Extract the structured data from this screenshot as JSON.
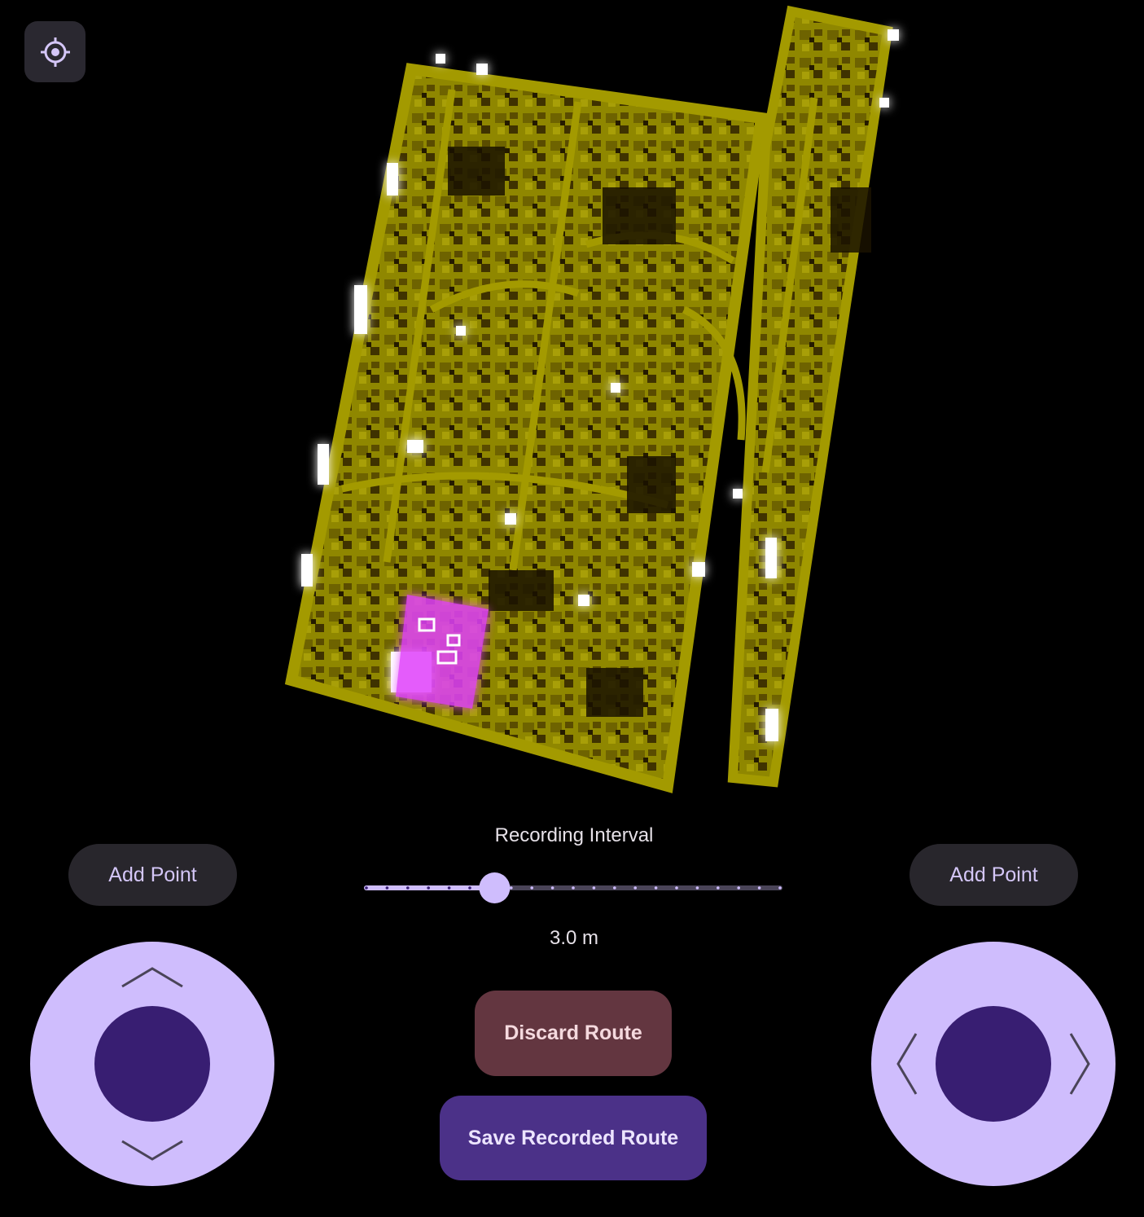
{
  "toolbar": {
    "recenter_icon": "locate-crosshair-icon"
  },
  "map": {
    "floor_color": "#a39a00",
    "current_position_color": "#e040fb"
  },
  "recording": {
    "label": "Recording Interval",
    "value_text": "3.0 m",
    "slider": {
      "steps": 20,
      "selected_step": 6,
      "value": 3.0
    }
  },
  "buttons": {
    "add_point_left": "Add Point",
    "add_point_right": "Add Point",
    "discard": "Discard Route",
    "save": "Save Recorded Route"
  },
  "joysticks": {
    "left": {
      "icons": [
        "chevron-up-icon",
        "chevron-down-icon"
      ]
    },
    "right": {
      "icons": [
        "chevron-left-icon",
        "chevron-right-icon"
      ]
    }
  },
  "colors": {
    "background": "#000000",
    "accent": "#cfbdfd",
    "knob": "#381e72",
    "discard_bg": "#633640",
    "save_bg": "#4b3188"
  }
}
